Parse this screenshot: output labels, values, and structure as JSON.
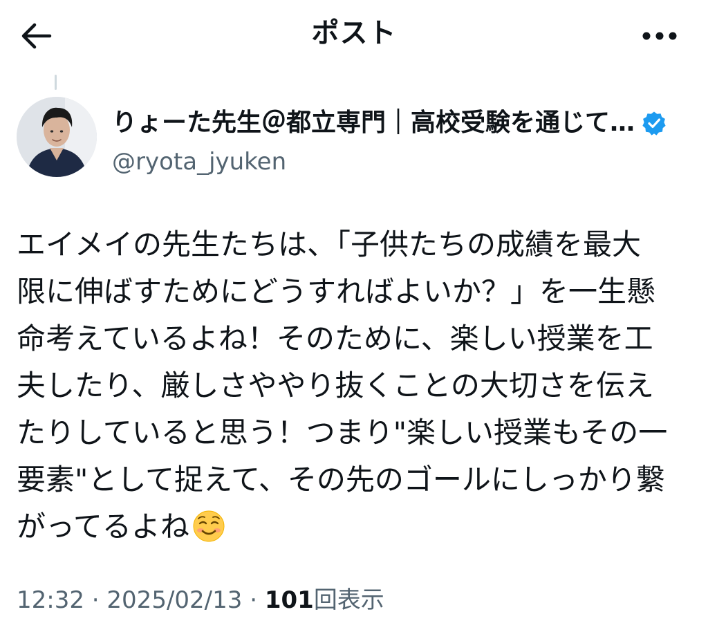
{
  "header": {
    "title": "ポスト",
    "back_icon": "arrow-left-icon",
    "more_icon": "more-horizontal-icon"
  },
  "author": {
    "display_name": "りょーた先生＠都立専門｜高校受験を通じて…",
    "handle": "@ryota_jyuken",
    "verified": true,
    "verified_color": "#1d9bf0"
  },
  "tweet": {
    "text": "エイメイの先生たちは、「子供たちの成績を最大\n限に伸ばすためにどうすればよいか？」を一生懸\n命考えているよね！そのために、楽しい授業を工\n夫したり、厳しさややり抜くことの大切さを伝え\nたりしていると思う！つまり\"楽しい授業もその一\n要素\"として捉えて、その先のゴールにしっかり繋\nがってるよね",
    "emoji": "smiling-face-emoji"
  },
  "meta": {
    "time": "12:32",
    "separator": "·",
    "date": "2025/02/13",
    "views_count": "101",
    "views_label": "回表示"
  }
}
